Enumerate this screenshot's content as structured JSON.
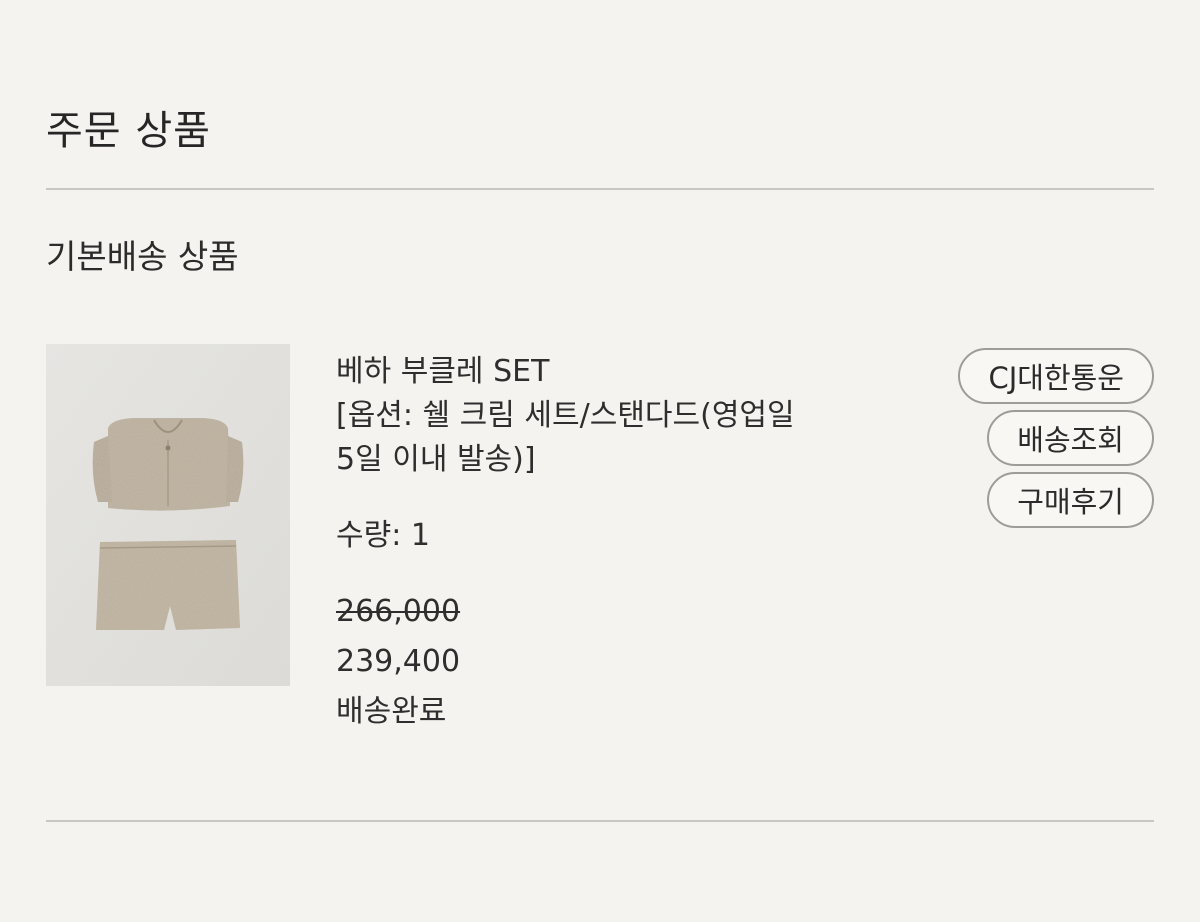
{
  "page": {
    "section_title": "주문 상품",
    "group_title": "기본배송 상품"
  },
  "product": {
    "name": "베하 부클레 SET",
    "option_line1": "[옵션: 쉘 크림 세트/스탠다드(영업일",
    "option_line2": "5일 이내 발송)]",
    "quantity": "수량: 1",
    "original_price": "266,000",
    "sale_price": "239,400",
    "status": "배송완료"
  },
  "actions": {
    "courier": "CJ대한통운",
    "track": "배송조회",
    "review": "구매후기"
  }
}
